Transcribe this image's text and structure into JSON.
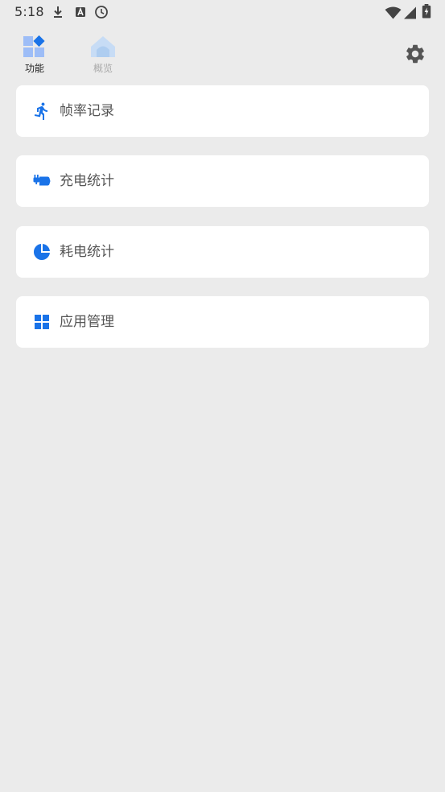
{
  "status_bar": {
    "time": "5:18",
    "icons": [
      "download-icon",
      "app-badge-icon",
      "clock-icon",
      "wifi-icon",
      "signal-icon",
      "battery-charging-icon"
    ]
  },
  "tabs": [
    {
      "label": "功能",
      "icon": "apps-icon",
      "active": true
    },
    {
      "label": "概览",
      "icon": "home-icon",
      "active": false
    }
  ],
  "settings": {
    "icon": "gear-icon"
  },
  "menu": [
    {
      "label": "帧率记录",
      "icon": "running-icon"
    },
    {
      "label": "充电统计",
      "icon": "charger-plug-icon"
    },
    {
      "label": "耗电统计",
      "icon": "pie-chart-icon"
    },
    {
      "label": "应用管理",
      "icon": "grid-icon"
    }
  ],
  "colors": {
    "accent": "#1a73e8",
    "accent_light": "#9dbdf7",
    "inactive_light": "#c7dcf5",
    "background": "#ebebeb",
    "card": "#ffffff"
  }
}
